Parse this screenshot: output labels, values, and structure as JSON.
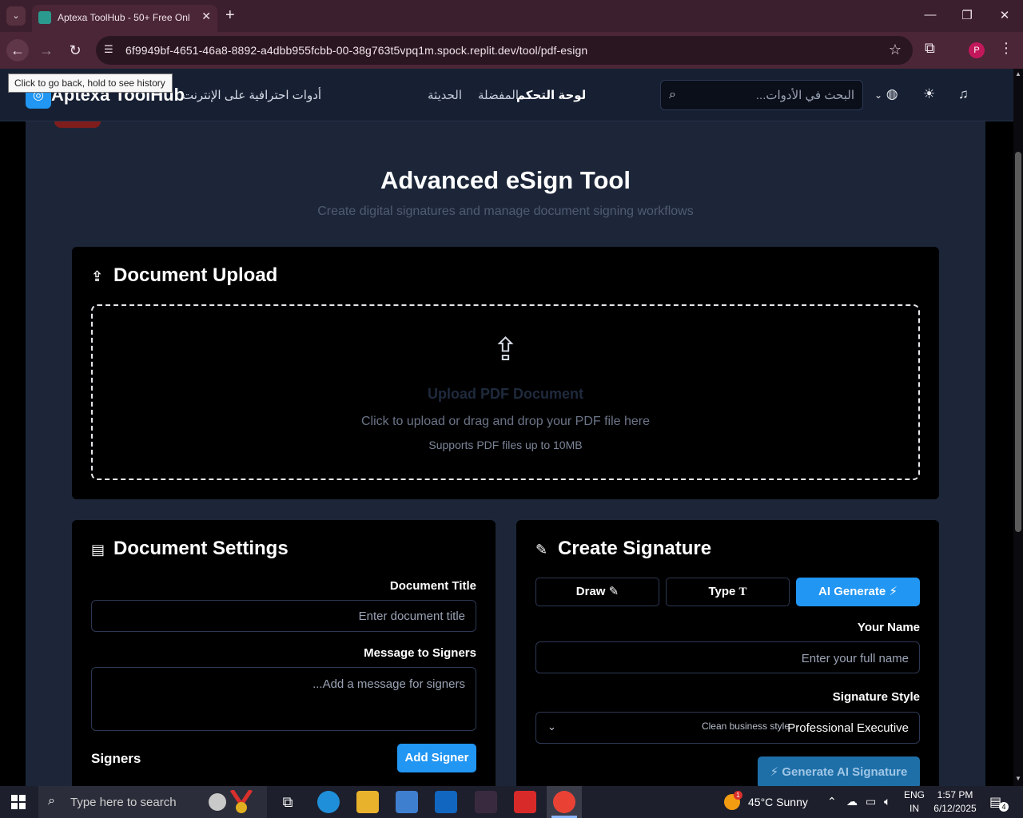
{
  "browser": {
    "tab_title": "Aptexa ToolHub - 50+ Free Onl",
    "new_tab_glyph": "+",
    "url": "6f9949bf-4651-46a8-8892-a4dbb955fcbb-00-38g763t5vpq1m.spock.replit.dev/tool/pdf-esign",
    "tooltip": "Click to go back, hold to see history",
    "profile_initial": "P"
  },
  "header": {
    "logo": "Aptexa ToolHub",
    "tagline": "أدوات احترافية على الإنترنت",
    "nav": [
      "الحديثة",
      "المفضلة",
      "لوحة التحكم"
    ],
    "search_placeholder": "البحث في الأدوات..."
  },
  "page": {
    "title": "Advanced eSign Tool",
    "subtitle": "Create digital signatures and manage document signing workflows"
  },
  "upload": {
    "title": "Document Upload",
    "drop_title": "Upload PDF Document",
    "drop_text": "Click to upload or drag and drop your PDF file here",
    "drop_note": "Supports PDF files up to 10MB"
  },
  "settings": {
    "title": "Document Settings",
    "doc_title_label": "Document Title",
    "doc_title_placeholder": "Enter document title",
    "message_label": "Message to Signers",
    "message_placeholder": "...Add a message for signers",
    "signers_label": "Signers",
    "add_signer": "Add Signer"
  },
  "signature": {
    "title": "Create Signature",
    "tabs": [
      "Draw",
      "Type",
      "AI Generate"
    ],
    "active_tab": "AI Generate",
    "name_label": "Your Name",
    "name_placeholder": "Enter your full name",
    "style_label": "Signature Style",
    "style_value": "Professional Executive",
    "style_desc": "Clean business style",
    "generate_button": "Generate AI Signature"
  },
  "taskbar": {
    "search_placeholder": "Type here to search",
    "weather": "45°C  Sunny",
    "weather_badge": "1",
    "lang_line1": "ENG",
    "lang_line2": "IN",
    "time": "1:57 PM",
    "date": "6/12/2025",
    "notifications": "4"
  },
  "colors": {
    "accent": "#2196f3",
    "page_bg": "#1c2638",
    "card_bg": "#000000"
  }
}
